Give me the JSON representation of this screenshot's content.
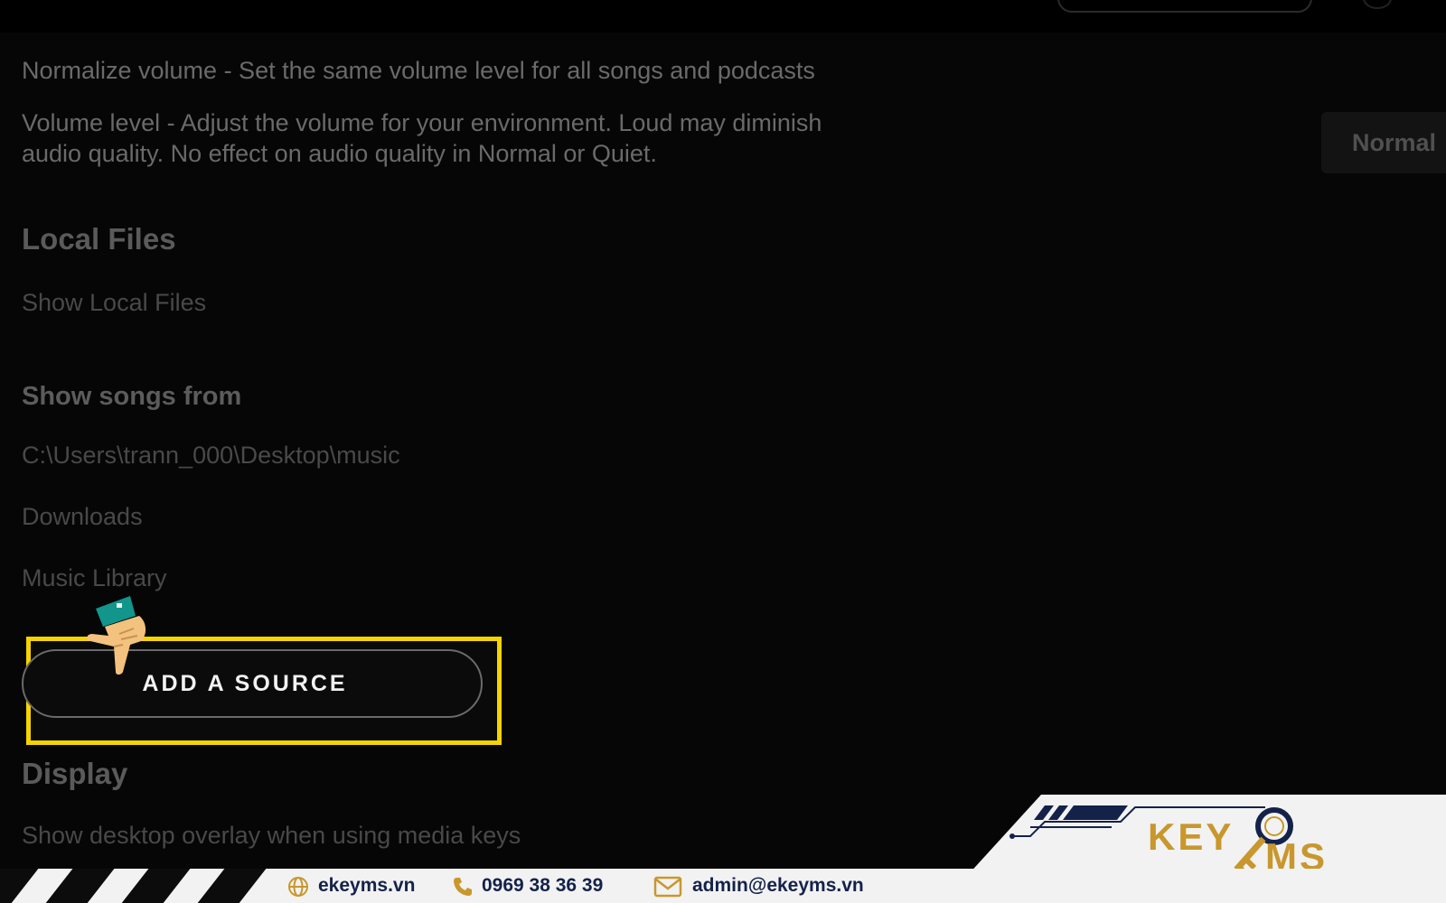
{
  "settings": {
    "normalize_volume": "Normalize volume - Set the same volume level for all songs and podcasts",
    "volume_level_line1": "Volume level - Adjust the volume for your environment. Loud may diminish",
    "volume_level_line2": "audio quality. No effect on audio quality in Normal or Quiet.",
    "volume_level_value": "Normal",
    "local_files_heading": "Local Files",
    "show_local_files": "Show Local Files",
    "show_songs_from_heading": "Show songs from",
    "sources": [
      "C:\\Users\\trann_000\\Desktop\\music",
      "Downloads",
      "Music Library"
    ],
    "add_source_label": "ADD A SOURCE",
    "display_heading": "Display",
    "show_overlay": "Show desktop overlay when using media keys"
  },
  "footer": {
    "website": "ekeyms.vn",
    "phone": "0969 38 36 39",
    "email": "admin@ekeyms.vn",
    "brand_left": "KEY",
    "brand_right": "MS"
  },
  "colors": {
    "highlight": "#f5d400",
    "brand_gold": "#c8972d",
    "brand_navy": "#14224a"
  },
  "icons": {
    "pointer": "hand-pointer-icon",
    "web": "globe-icon",
    "phone": "phone-icon",
    "email": "mail-icon",
    "logo": "key-icon"
  }
}
